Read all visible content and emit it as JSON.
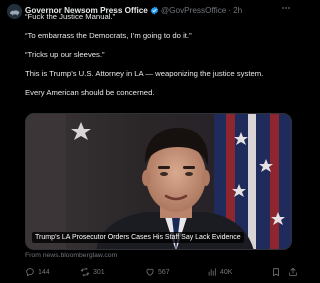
{
  "post": {
    "author": {
      "display_name": "Governor Newsom Press Office",
      "handle": "@GovPressOffice",
      "separator": "·",
      "timestamp": "2h",
      "avatar_icon": "bear-flag-avatar",
      "verified_icon": "verified-badge-icon"
    },
    "text": [
      "“Fuck the Justice Manual.”",
      "“To embarrass the Democrats, I’m going to do it.”",
      "“Tricks up our sleeves.”",
      "This is Trump’s U.S. Attorney in LA — weaponizing the justice system.",
      "Every American should be concerned."
    ],
    "media": {
      "caption": "Trump’s LA Prosecutor Orders Cases His Staff Say Lack Evidence",
      "source": "From news.bloomberglaw.com"
    },
    "actions": {
      "replies": "144",
      "reposts": "301",
      "likes": "567",
      "views": "40K"
    }
  },
  "colors": {
    "background": "#000000",
    "text": "#e7e9ea",
    "muted": "#71767b",
    "verified": "#1d9bf0"
  }
}
